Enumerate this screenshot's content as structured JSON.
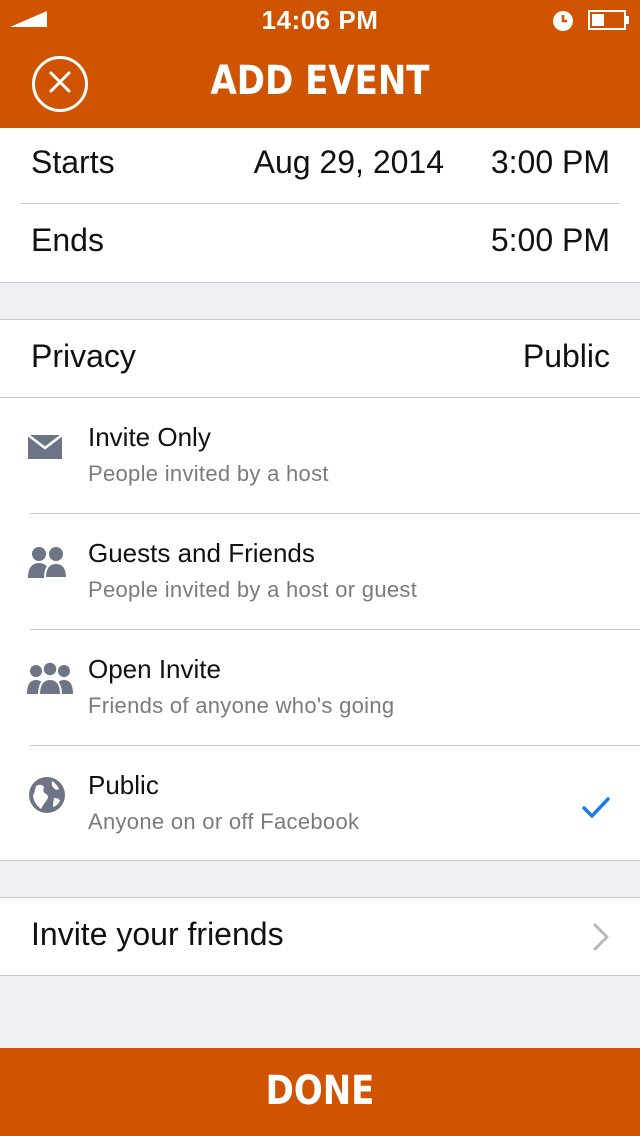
{
  "status_bar": {
    "time": "14:06 PM"
  },
  "header": {
    "title": "ADD EVENT"
  },
  "schedule": {
    "starts_label": "Starts",
    "starts_date": "Aug 29, 2014",
    "starts_time": "3:00 PM",
    "ends_label": "Ends",
    "ends_time": "5:00 PM"
  },
  "privacy": {
    "label": "Privacy",
    "value": "Public",
    "options": [
      {
        "title": "Invite Only",
        "subtitle": "People invited by a host",
        "icon": "envelope-icon"
      },
      {
        "title": "Guests and Friends",
        "subtitle": "People invited by a host or guest",
        "icon": "two-people-icon"
      },
      {
        "title": "Open Invite",
        "subtitle": "Friends of anyone who's going",
        "icon": "three-people-icon"
      },
      {
        "title": "Public",
        "subtitle": "Anyone on or off Facebook",
        "icon": "globe-icon",
        "selected": true
      }
    ]
  },
  "invite": {
    "label": "Invite your friends"
  },
  "footer": {
    "done_label": "DONE"
  },
  "colors": {
    "accent": "#d05301",
    "check": "#1a7ee8",
    "icon": "#6d7486"
  }
}
